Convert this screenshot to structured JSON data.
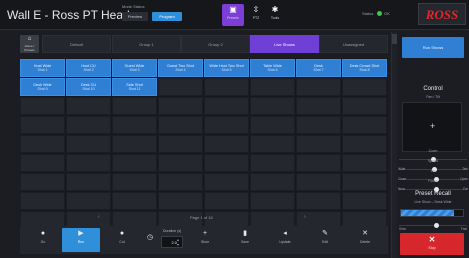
{
  "header": {
    "title": "Wall E - Ross PT Head",
    "mode_label": "Mode Status",
    "mode_preview": "Preview",
    "mode_program": "Program",
    "buttons": [
      {
        "label": "Presets",
        "icon": "presets-icon",
        "glyph": "▣"
      },
      {
        "label": "PTZ",
        "icon": "ptz-icon",
        "glyph": "⇳"
      },
      {
        "label": "Tools",
        "icon": "gear-icon",
        "glyph": "✱"
      }
    ],
    "status_label": "Status",
    "status_value": "OK",
    "logo": "ROSS",
    "colors": {
      "accent_purple": "#7b3ed6",
      "accent_blue": "#2f80d4",
      "status_green": "#3ec54a",
      "brand_red": "#e2262a"
    }
  },
  "tabs": {
    "home": {
      "label": "Home / Presets",
      "glyph": "⌂"
    },
    "items": [
      {
        "label": "Default",
        "active": false
      },
      {
        "label": "Group 1",
        "active": false
      },
      {
        "label": "Group 2",
        "active": false
      },
      {
        "label": "Live Shows",
        "active": true
      },
      {
        "label": "Unassigned",
        "active": false
      }
    ]
  },
  "grid": {
    "rows": 10,
    "cols": 8,
    "presets": [
      {
        "name": "Host Wide",
        "sub": "Shot 1"
      },
      {
        "name": "Host CU",
        "sub": "Shot 2"
      },
      {
        "name": "Guest Wide",
        "sub": "Shot 3"
      },
      {
        "name": "Guest Two Shot",
        "sub": "Shot 4"
      },
      {
        "name": "Wide Host Two Shot",
        "sub": "Shot 5"
      },
      {
        "name": "Table Wide",
        "sub": "Shot 6"
      },
      {
        "name": "Desk",
        "sub": "Shot 7"
      },
      {
        "name": "Desk Crowd Shot",
        "sub": "Shot 8"
      },
      {
        "name": "Desk Wide",
        "sub": "Shot 9"
      },
      {
        "name": "Desk CU",
        "sub": "Shot 10"
      },
      {
        "name": "Side Shot",
        "sub": "Shot 11"
      }
    ]
  },
  "pager": {
    "prev": "‹",
    "text": "Page 1 of 16",
    "next": "›"
  },
  "toolbar": {
    "tools": [
      {
        "label": "Go",
        "glyph": "●",
        "icon": "go-icon",
        "active": false
      },
      {
        "label": "Run",
        "glyph": "▶",
        "icon": "run-icon",
        "active": true
      },
      {
        "label": "Cut",
        "glyph": "●",
        "icon": "cut-icon",
        "active": false
      },
      {
        "label": "Store",
        "glyph": "+",
        "icon": "store-icon",
        "active": false
      },
      {
        "label": "Save",
        "glyph": "▮",
        "icon": "save-icon",
        "active": false
      },
      {
        "label": "Update",
        "glyph": "◂",
        "icon": "update-icon",
        "active": false
      },
      {
        "label": "Edit",
        "glyph": "✎",
        "icon": "edit-icon",
        "active": false
      },
      {
        "label": "Delete",
        "glyph": "✕",
        "icon": "delete-icon",
        "active": false
      }
    ],
    "duration_label": "Duration (s)",
    "duration_value": "2.0",
    "duration_glyph": "◷"
  },
  "side": {
    "button_label": "Run Shows",
    "control_title": "Control",
    "control_sub": "Pan / Tilt",
    "joystick_glyph": "+",
    "sliders": [
      {
        "label": "Zoom",
        "lo": "",
        "hi": "",
        "value": 0.5
      },
      {
        "label": "Speed",
        "lo": "Wide",
        "hi": "Tele",
        "value": 0.52
      },
      {
        "label": "Iris",
        "lo": "Close",
        "hi": "Open",
        "value": 0.55
      },
      {
        "label": "Focus",
        "lo": "Near",
        "hi": "Far",
        "value": 0.55
      }
    ],
    "preset_title": "Preset Recall",
    "preset_sub": "Live Show – Desk Wide",
    "preset_progress": 0.85,
    "preset_mini_lo": "Slow",
    "preset_mini_hi": "Fast",
    "preset_mini_value": 0.55,
    "stop_label": "Stop",
    "stop_glyph": "✕"
  }
}
